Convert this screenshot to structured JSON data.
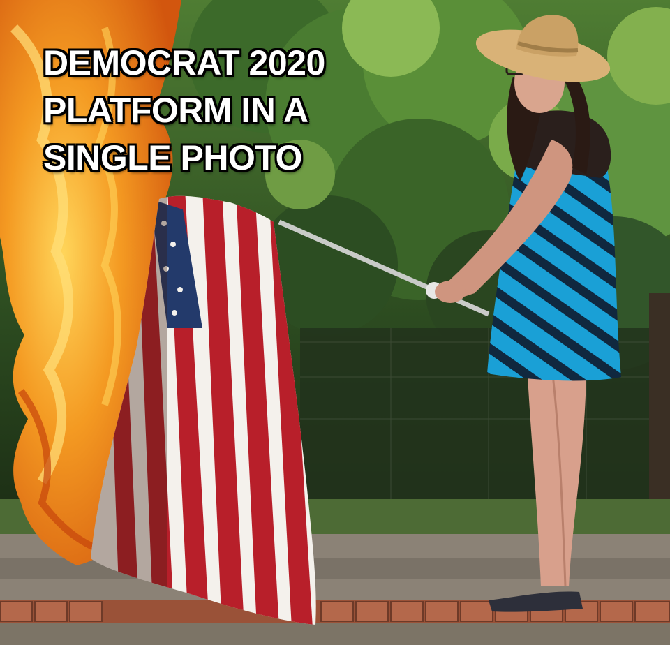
{
  "meme": {
    "caption_lines": [
      "DEMOCRAT 2020",
      "PLATFORM IN A",
      "SINGLE PHOTO"
    ]
  },
  "colors": {
    "foliage_dark": "#1f3418",
    "foliage_mid": "#3f6a2c",
    "foliage_light": "#7fae4a",
    "flame_orange": "#f08a1c",
    "flame_yellow": "#ffc23a",
    "flag_red": "#b81f2a",
    "flag_white": "#f4f1ec",
    "flag_blue": "#233a6b",
    "dress_blue": "#1aa0d6",
    "dress_navy": "#10283f",
    "hat_straw": "#d9b277",
    "brick": "#a45a3e",
    "pavement": "#8b8276"
  }
}
